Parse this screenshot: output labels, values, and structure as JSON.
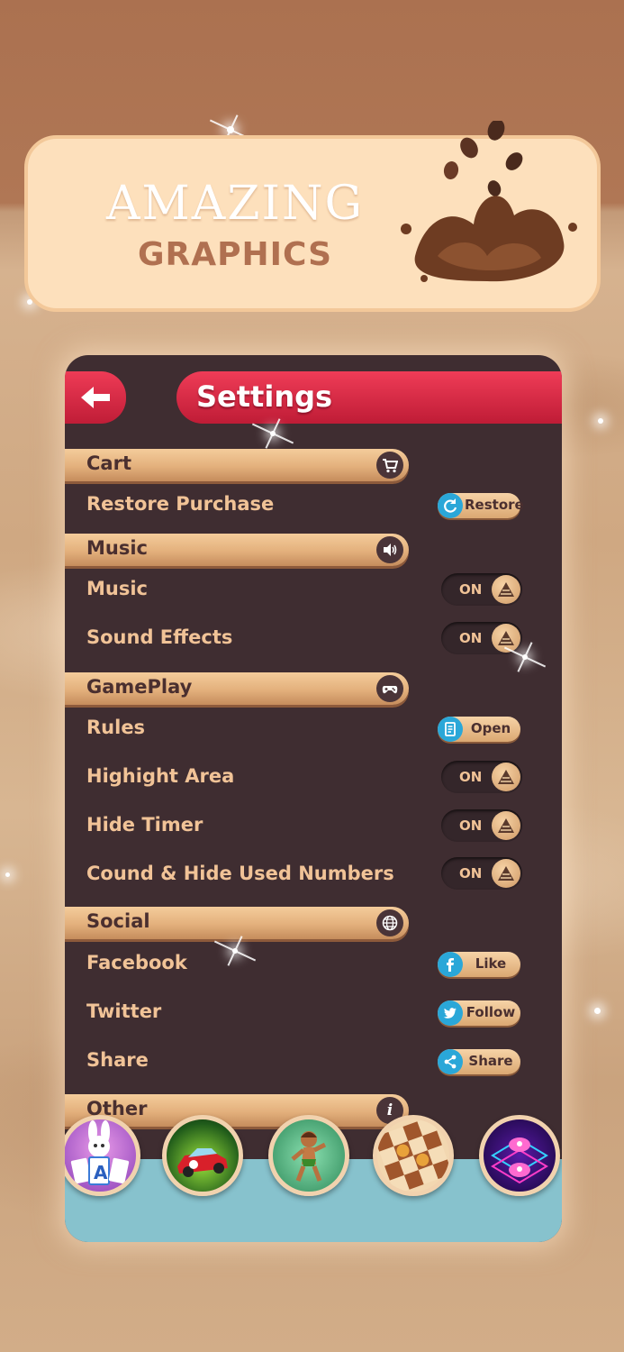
{
  "banner": {
    "line1": "AMAZING",
    "line2": "GRAPHICS"
  },
  "header": {
    "title": "Settings",
    "back_icon": "arrow-left-icon"
  },
  "sections": {
    "cart": {
      "label": "Cart",
      "icon": "cart-icon"
    },
    "music": {
      "label": "Music",
      "icon": "speaker-icon"
    },
    "gameplay": {
      "label": "GamePlay",
      "icon": "gamepad-icon"
    },
    "social": {
      "label": "Social",
      "icon": "globe-icon"
    },
    "other": {
      "label": "Other",
      "icon": "info-icon"
    }
  },
  "rows": {
    "restore": {
      "label": "Restore Purchase",
      "button": "Restore",
      "icon": "refresh-icon"
    },
    "music": {
      "label": "Music",
      "state": "ON"
    },
    "sound": {
      "label": "Sound Effects",
      "state": "ON"
    },
    "rules": {
      "label": "Rules",
      "button": "Open",
      "icon": "document-icon"
    },
    "highlight": {
      "label": "Highight Area",
      "state": "ON"
    },
    "hide_timer": {
      "label": "Hide Timer",
      "state": "ON"
    },
    "hide_numbers": {
      "label": "Cound & Hide Used Numbers",
      "state": "ON"
    },
    "facebook": {
      "label": "Facebook",
      "button": "Like",
      "icon": "facebook-icon"
    },
    "twitter": {
      "label": "Twitter",
      "button": "Follow",
      "icon": "twitter-icon"
    },
    "share": {
      "label": "Share",
      "button": "Share",
      "icon": "share-icon"
    }
  },
  "games": [
    "bunny-solitaire",
    "race-car",
    "jungle-runner",
    "checkers",
    "space-monsters"
  ],
  "colors": {
    "accent_red": "#e3304c",
    "panel": "#3f2d31",
    "tan": "#e3b07c",
    "label": "#f1c397",
    "blue": "#2aa7d8"
  }
}
